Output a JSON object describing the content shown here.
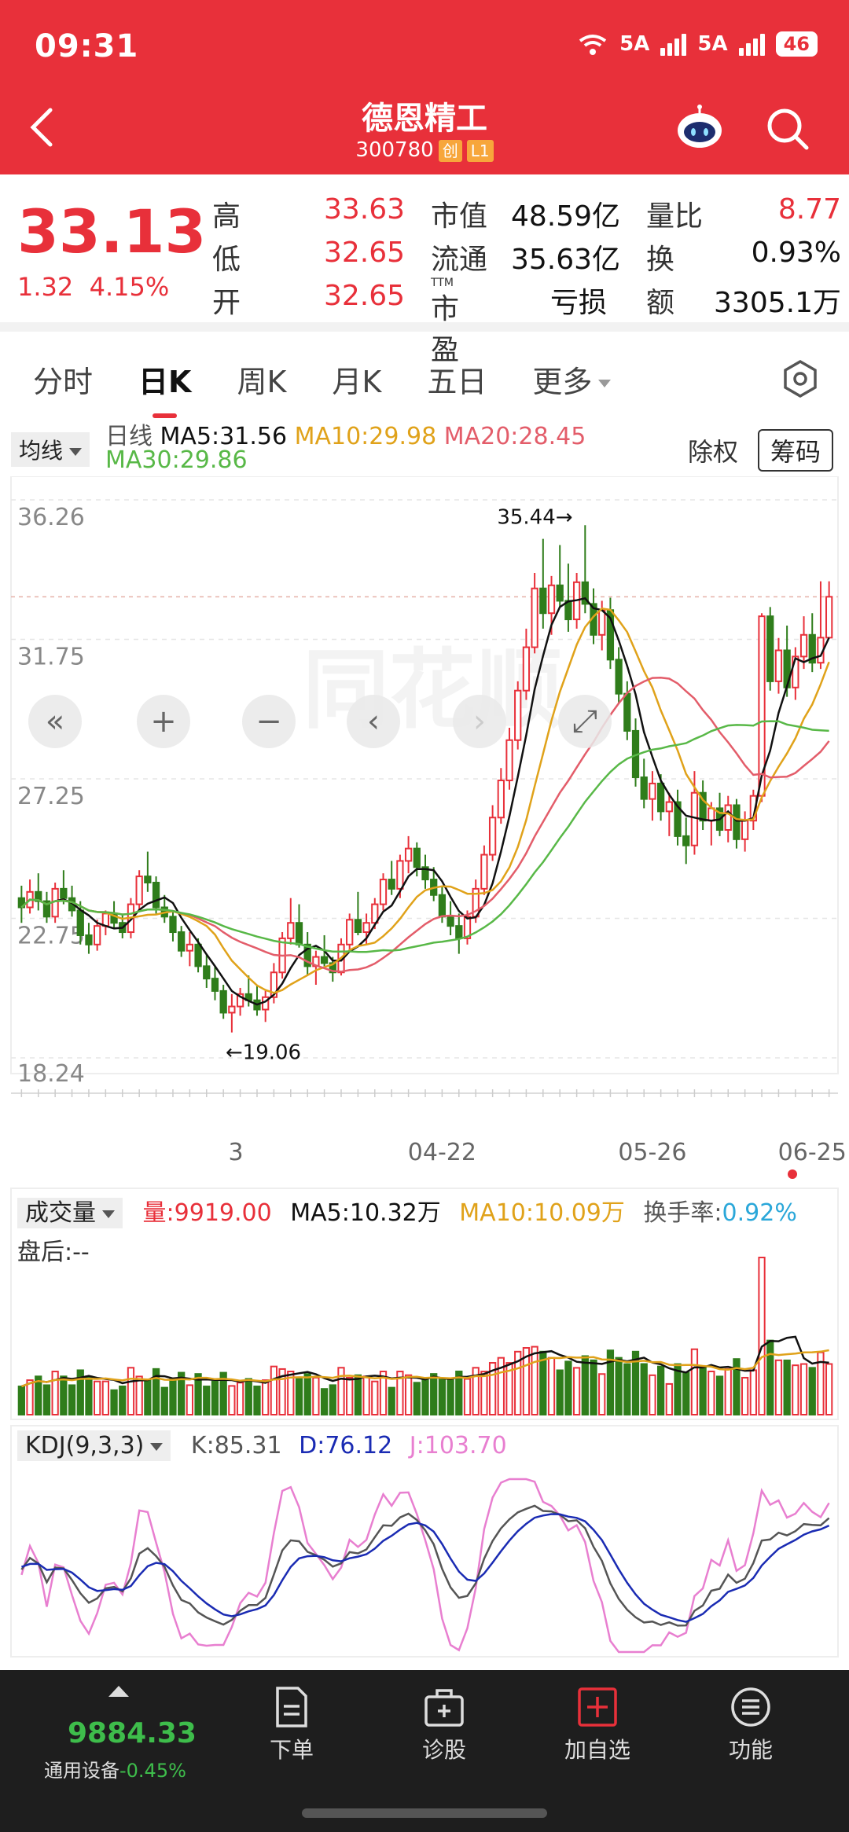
{
  "status": {
    "time": "09:31",
    "sig1": "5A",
    "sig2": "5A",
    "battery": "46"
  },
  "header": {
    "name": "德恩精工",
    "code": "300780",
    "tag1": "创",
    "tag2": "L1"
  },
  "quote": {
    "price": "33.13",
    "change": "1.32",
    "change_pct": "4.15%",
    "rows": [
      {
        "l1": "高",
        "v1": "33.63",
        "l2": "市值",
        "v2": "48.59亿",
        "l3": "量比",
        "v3": "8.77"
      },
      {
        "l1": "低",
        "v1": "32.65",
        "l2": "流通",
        "v2": "35.63亿",
        "l3": "换",
        "v3": "0.93%"
      },
      {
        "l1": "开",
        "v1": "32.65",
        "l2": "市盈",
        "l2sup": "TTM",
        "v2": "亏损",
        "l3": "额",
        "v3": "3305.1万"
      }
    ]
  },
  "tabs": [
    {
      "label": "分时",
      "active": false
    },
    {
      "label": "日K",
      "active": true
    },
    {
      "label": "周K",
      "active": false
    },
    {
      "label": "月K",
      "active": false
    },
    {
      "label": "五日",
      "active": false
    },
    {
      "label": "更多",
      "active": false
    }
  ],
  "legend": {
    "ma_button": "均线",
    "prefix": "日线",
    "ma5": "MA5:31.56",
    "ma10": "MA10:29.98",
    "ma20": "MA20:28.45",
    "ma30": "MA30:29.86",
    "chuquan": "除权",
    "chouma": "筹码"
  },
  "colors": {
    "up": "#e8303a",
    "down": "#2f7d1b",
    "ma5": "#111111",
    "ma10": "#e0a21a",
    "ma20": "#e35d6a",
    "ma30": "#58b847",
    "k": "#555555",
    "d": "#1a2bb3",
    "j": "#e87fd0"
  },
  "chart_data": {
    "type": "candlestick",
    "price_axis": {
      "ticks": [
        "36.26",
        "31.75",
        "27.25",
        "22.75",
        "18.24"
      ],
      "ylim": [
        18.24,
        36.26
      ]
    },
    "x_labels": [
      "3",
      "04-22",
      "05-26",
      "06-25"
    ],
    "high_marker": "35.44",
    "low_marker": "19.06",
    "ohlc": [
      [
        23.4,
        23.8,
        22.6,
        23.1
      ],
      [
        23.1,
        24.0,
        22.9,
        23.6
      ],
      [
        23.6,
        24.2,
        23.0,
        23.3
      ],
      [
        23.3,
        23.6,
        22.6,
        22.8
      ],
      [
        22.8,
        23.9,
        22.6,
        23.7
      ],
      [
        23.7,
        24.3,
        23.2,
        23.4
      ],
      [
        23.4,
        23.8,
        22.8,
        23.0
      ],
      [
        23.0,
        23.3,
        21.9,
        22.2
      ],
      [
        22.2,
        22.6,
        21.6,
        21.9
      ],
      [
        21.9,
        22.7,
        21.7,
        22.5
      ],
      [
        22.5,
        23.0,
        22.2,
        22.9
      ],
      [
        22.9,
        23.3,
        22.4,
        22.6
      ],
      [
        22.6,
        22.9,
        22.1,
        22.3
      ],
      [
        22.3,
        23.4,
        22.1,
        23.2
      ],
      [
        23.2,
        24.3,
        23.0,
        24.1
      ],
      [
        24.1,
        24.9,
        23.6,
        23.9
      ],
      [
        23.9,
        24.1,
        22.9,
        23.1
      ],
      [
        23.1,
        23.5,
        22.6,
        22.8
      ],
      [
        22.8,
        23.0,
        22.0,
        22.3
      ],
      [
        22.3,
        22.5,
        21.5,
        21.7
      ],
      [
        21.7,
        22.3,
        21.2,
        21.9
      ],
      [
        21.9,
        22.1,
        21.0,
        21.2
      ],
      [
        21.2,
        21.6,
        20.5,
        20.8
      ],
      [
        20.8,
        21.2,
        20.1,
        20.4
      ],
      [
        20.4,
        20.6,
        19.5,
        19.7
      ],
      [
        19.7,
        20.3,
        19.06,
        19.9
      ],
      [
        19.9,
        20.5,
        19.6,
        20.3
      ],
      [
        20.3,
        20.9,
        19.9,
        20.1
      ],
      [
        20.1,
        20.6,
        19.6,
        19.8
      ],
      [
        19.8,
        20.4,
        19.4,
        20.2
      ],
      [
        20.2,
        21.3,
        20.0,
        21.0
      ],
      [
        21.0,
        22.3,
        20.8,
        22.1
      ],
      [
        22.1,
        23.4,
        21.9,
        22.6
      ],
      [
        22.6,
        23.2,
        21.8,
        21.9
      ],
      [
        21.9,
        22.3,
        20.9,
        21.2
      ],
      [
        21.2,
        21.7,
        20.6,
        21.5
      ],
      [
        21.5,
        22.2,
        21.2,
        21.3
      ],
      [
        21.3,
        21.5,
        20.7,
        21.0
      ],
      [
        21.0,
        22.1,
        20.9,
        21.9
      ],
      [
        21.9,
        22.9,
        21.7,
        22.7
      ],
      [
        22.7,
        23.6,
        22.2,
        22.3
      ],
      [
        22.3,
        22.9,
        21.9,
        22.6
      ],
      [
        22.6,
        23.4,
        22.4,
        23.2
      ],
      [
        23.2,
        24.2,
        23.0,
        24.0
      ],
      [
        24.0,
        24.6,
        23.5,
        23.7
      ],
      [
        23.7,
        24.8,
        23.4,
        24.6
      ],
      [
        24.6,
        25.4,
        24.2,
        25.0
      ],
      [
        25.0,
        25.2,
        24.1,
        24.4
      ],
      [
        24.4,
        24.8,
        23.7,
        24.0
      ],
      [
        24.0,
        24.4,
        23.3,
        23.5
      ],
      [
        23.5,
        23.8,
        22.6,
        22.8
      ],
      [
        22.8,
        23.3,
        22.2,
        22.5
      ],
      [
        22.5,
        22.9,
        21.6,
        22.1
      ],
      [
        22.1,
        23.0,
        21.9,
        22.8
      ],
      [
        22.8,
        24.0,
        22.6,
        23.7
      ],
      [
        23.7,
        25.1,
        23.5,
        24.8
      ],
      [
        24.8,
        26.4,
        24.6,
        26.0
      ],
      [
        26.0,
        27.6,
        25.8,
        27.2
      ],
      [
        27.2,
        28.9,
        26.9,
        28.5
      ],
      [
        28.5,
        30.4,
        28.2,
        30.1
      ],
      [
        30.1,
        32.1,
        29.8,
        31.5
      ],
      [
        31.5,
        33.9,
        31.3,
        33.4
      ],
      [
        33.4,
        35.0,
        32.1,
        32.6
      ],
      [
        32.6,
        33.8,
        31.9,
        33.5
      ],
      [
        33.5,
        34.8,
        32.8,
        33.0
      ],
      [
        33.0,
        34.2,
        32.0,
        32.4
      ],
      [
        32.4,
        33.9,
        32.1,
        33.6
      ],
      [
        33.6,
        35.44,
        32.6,
        32.9
      ],
      [
        32.9,
        33.4,
        31.6,
        31.9
      ],
      [
        31.9,
        33.0,
        31.4,
        32.7
      ],
      [
        32.7,
        33.1,
        30.8,
        31.1
      ],
      [
        31.1,
        31.5,
        29.7,
        30.0
      ],
      [
        30.0,
        30.4,
        28.5,
        28.8
      ],
      [
        28.8,
        29.2,
        27.0,
        27.3
      ],
      [
        27.3,
        27.9,
        26.3,
        26.6
      ],
      [
        26.6,
        27.5,
        25.9,
        27.1
      ],
      [
        27.1,
        27.4,
        25.9,
        26.2
      ],
      [
        26.2,
        26.8,
        25.4,
        26.5
      ],
      [
        26.5,
        26.9,
        25.1,
        25.4
      ],
      [
        25.4,
        26.0,
        24.5,
        25.1
      ],
      [
        25.1,
        27.5,
        24.8,
        26.8
      ],
      [
        26.8,
        27.2,
        25.6,
        25.9
      ],
      [
        25.9,
        26.5,
        25.1,
        26.3
      ],
      [
        26.3,
        26.8,
        25.4,
        25.6
      ],
      [
        25.6,
        26.7,
        25.2,
        26.4
      ],
      [
        26.4,
        26.6,
        25.0,
        25.3
      ],
      [
        25.3,
        26.2,
        24.9,
        25.9
      ],
      [
        25.9,
        26.9,
        25.6,
        26.7
      ],
      [
        26.7,
        32.6,
        26.5,
        32.5
      ],
      [
        32.5,
        32.8,
        30.1,
        30.4
      ],
      [
        30.4,
        31.8,
        30.0,
        31.4
      ],
      [
        31.4,
        32.2,
        29.9,
        30.2
      ],
      [
        30.2,
        31.5,
        29.8,
        31.2
      ],
      [
        31.2,
        32.5,
        30.8,
        31.9
      ],
      [
        31.9,
        32.6,
        30.7,
        31.0
      ],
      [
        31.0,
        33.63,
        30.8,
        31.81
      ],
      [
        31.81,
        33.63,
        32.65,
        33.13
      ]
    ],
    "volume": {
      "label": "成交量",
      "current": "量:9919.00",
      "ma5": "MA5:10.32万",
      "ma10": "MA10:10.09万",
      "turnover_label": "换手率:",
      "turnover": "0.92%",
      "after_hours": "盘后:--"
    },
    "kdj": {
      "label": "KDJ(9,3,3)",
      "k": "K:85.31",
      "d": "D:76.12",
      "j": "J:103.70"
    }
  },
  "bottom": {
    "index_value": "9884.33",
    "index_name": "通用设备",
    "index_change": "-0.45%",
    "nav": [
      "下单",
      "诊股",
      "加自选",
      "功能"
    ]
  }
}
